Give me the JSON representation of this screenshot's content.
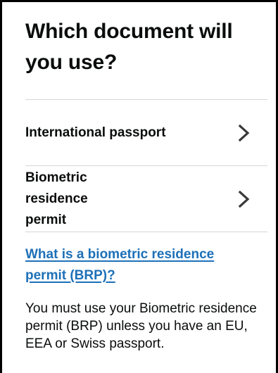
{
  "page": {
    "heading": "Which document will you use?"
  },
  "options": [
    {
      "label": "International passport",
      "icon": "chevron-right-icon"
    },
    {
      "label": "Biometric residence permit",
      "icon": "chevron-right-icon"
    }
  ],
  "help_link": {
    "text": "What is a biometric residence permit (BRP)?"
  },
  "info": {
    "text": "You must use your Biometric residence permit (BRP) unless you have an EU, EEA or Swiss passport."
  },
  "colors": {
    "text": "#0b0c0c",
    "link": "#1d70b8",
    "divider": "#d3d5d8",
    "chevron": "#383838"
  }
}
